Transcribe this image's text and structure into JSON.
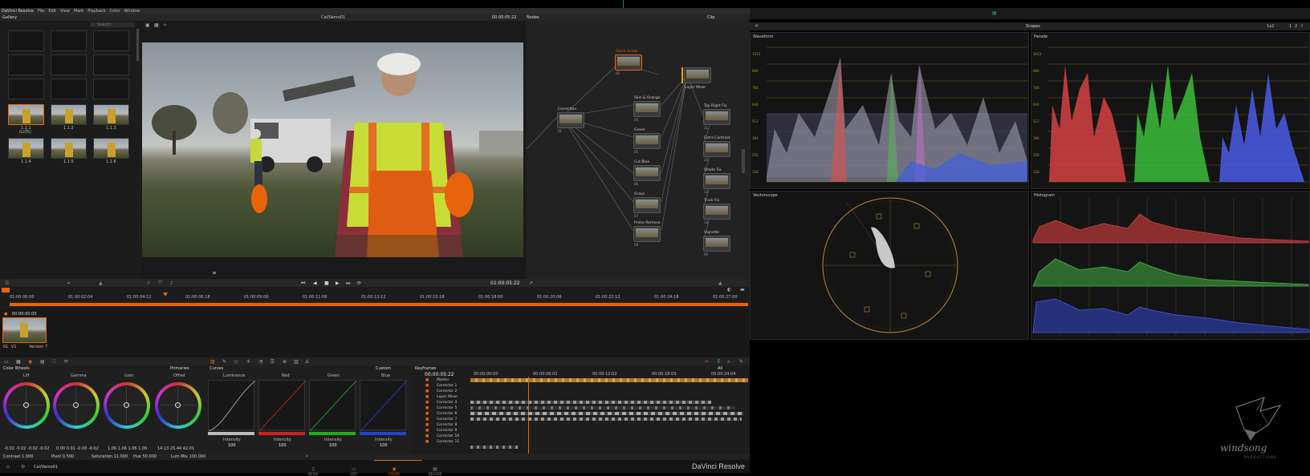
{
  "menubar": {
    "app": "DaVinci Resolve",
    "items": [
      "File",
      "Edit",
      "View",
      "Mark",
      "Playback",
      "Color",
      "Window"
    ]
  },
  "gallery": {
    "title": "Gallery",
    "search_placeholder": "Search",
    "stills": [
      {
        "label": "1.1.1",
        "sub": "(LUTs)"
      },
      {
        "label": "1.1.2",
        "sub": ""
      },
      {
        "label": "1.1.3",
        "sub": ""
      },
      {
        "label": "1.1.4",
        "sub": ""
      },
      {
        "label": "1.1.5",
        "sub": ""
      },
      {
        "label": "1.1.6",
        "sub": ""
      }
    ]
  },
  "viewer": {
    "clip_name": "Cal/Vamo01",
    "timecode_top": "00:00:05:22",
    "timecode": "01:00:05:22"
  },
  "nodes": {
    "title": "Nodes",
    "mode": "Clip",
    "items": [
      {
        "label": "Correction",
        "num": "01"
      },
      {
        "label": "Stock Grade",
        "num": "02"
      },
      {
        "label": "Layer Mixer",
        "num": ""
      },
      {
        "label": "Skin & Orange",
        "num": "04"
      },
      {
        "label": "Green",
        "num": "05"
      },
      {
        "label": "Cut Blue",
        "num": "06"
      },
      {
        "label": "Grays",
        "num": "07"
      },
      {
        "label": "Prime Remove",
        "num": "08"
      },
      {
        "label": "Top Right Fix",
        "num": "11"
      },
      {
        "label": "Extra Contrast",
        "num": "10"
      },
      {
        "label": "Shade Fix",
        "num": "12"
      },
      {
        "label": "Track Fix",
        "num": "13"
      },
      {
        "label": "Vignette",
        "num": "09"
      }
    ]
  },
  "timeline": {
    "ticks": [
      "01:00:00:00",
      "01:00:02:04",
      "01:00:04:12",
      "01:00:06:18",
      "01:00:09:00",
      "01:00:11:06",
      "01:00:13:12",
      "01:00:15:18",
      "01:00:18:00",
      "01:00:20:06",
      "01:00:22:12",
      "01:00:24:18",
      "01:00:27:00"
    ],
    "clip_timecode": "00:00:00:00",
    "clip_label": "V1",
    "clip_num": "01",
    "version": "Version 7"
  },
  "color_wheels": {
    "title": "Color Wheels",
    "mode": "Primaries",
    "wheels": [
      {
        "name": "Lift",
        "values": "-0.02  -0.02  -0.02  -0.02"
      },
      {
        "name": "Gamma",
        "values": "0.00  0.01  -0.00  -0.02"
      },
      {
        "name": "Gain",
        "values": "1.06  1.06  1.06  1.06"
      },
      {
        "name": "Offset",
        "values": "14.13  25.44  42.01"
      }
    ],
    "footer": {
      "contrast": "Contrast 1.000",
      "pivot": "Pivot 0.500",
      "saturation": "Saturation 11.000",
      "hue": "Hue 50.000",
      "lum_mix": "Lum Mix 100.000"
    }
  },
  "curves": {
    "title": "Curves",
    "mode": "Custom",
    "channels": [
      {
        "name": "Luminance",
        "intensity_label": "Intensity",
        "intensity": "100",
        "color": "#bbbbbb"
      },
      {
        "name": "Red",
        "intensity_label": "Intensity",
        "intensity": "100",
        "color": "#cc2222"
      },
      {
        "name": "Green",
        "intensity_label": "Intensity",
        "intensity": "100",
        "color": "#22aa22"
      },
      {
        "name": "Blue",
        "intensity_label": "Intensity",
        "intensity": "100",
        "color": "#2244cc"
      }
    ]
  },
  "keyframes": {
    "title": "Keyframes",
    "filter": "All",
    "timecode": "00:00:05:22",
    "ruler": [
      "00:00:00:00",
      "00:00:06:01",
      "00:00:12:02",
      "00:00:18:03",
      "00:00:24:04"
    ],
    "rows": [
      "Master",
      "Corrector 1",
      "Corrector 2",
      "Layer Mixer",
      "Corrector 4",
      "Corrector 5",
      "Corrector 6",
      "Corrector 7",
      "Corrector 8",
      "Corrector 9",
      "Corrector 10",
      "Corrector 11"
    ]
  },
  "pages": [
    "MEDIA",
    "EDIT",
    "COLOR",
    "DELIVER"
  ],
  "active_page": "COLOR",
  "project_name": "Cal/Vamo01",
  "brand": "DaVinci Resolve",
  "scopes": {
    "title": "Scopes",
    "layout": "1x2",
    "panels": {
      "waveform": {
        "name": "Waveform",
        "ticks": [
          "1023",
          "896",
          "768",
          "640",
          "512",
          "384",
          "256",
          "128",
          "0"
        ]
      },
      "parade": {
        "name": "Parade",
        "ticks": [
          "1023",
          "896",
          "768",
          "640",
          "512",
          "384",
          "256",
          "128",
          "0"
        ]
      },
      "vectorscope": {
        "name": "Vectorscope"
      },
      "histogram": {
        "name": "Histogram"
      }
    }
  },
  "watermark": {
    "text": "windsong",
    "sub": "PRODUCTIONS"
  },
  "colors": {
    "accent": "#e8640a",
    "panel": "#1e1e1e",
    "scope_bg": "#141414"
  }
}
